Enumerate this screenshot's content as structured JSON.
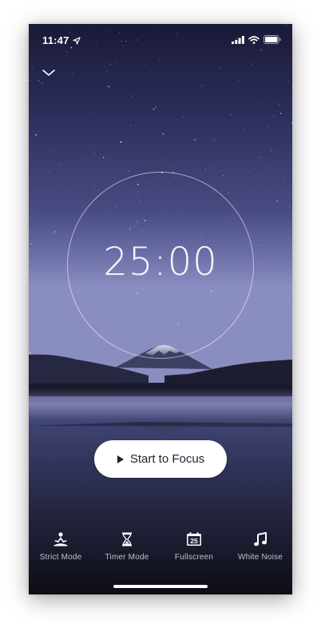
{
  "status_bar": {
    "time": "11:47",
    "icons": [
      "location-arrow-icon",
      "cellular-signal-icon",
      "wifi-icon",
      "battery-icon"
    ]
  },
  "header": {
    "collapse_icon": "chevron-down-icon"
  },
  "timer": {
    "display": "25:00"
  },
  "start_button": {
    "label": "Start to Focus",
    "icon": "play-icon"
  },
  "toolbar": {
    "items": [
      {
        "label": "Strict Mode",
        "icon": "meditation-icon"
      },
      {
        "label": "Timer Mode",
        "icon": "hourglass-icon"
      },
      {
        "label": "Fullscreen",
        "icon": "calendar-icon",
        "icon_text": "25"
      },
      {
        "label": "White Noise",
        "icon": "music-note-icon"
      }
    ]
  },
  "colors": {
    "sky_top": "#1d1e3f",
    "sky_mid": "#4a4d85",
    "horizon": "#7f82b8",
    "water": "#2e3252",
    "button_bg": "#ffffff",
    "button_text": "#1e2030"
  }
}
